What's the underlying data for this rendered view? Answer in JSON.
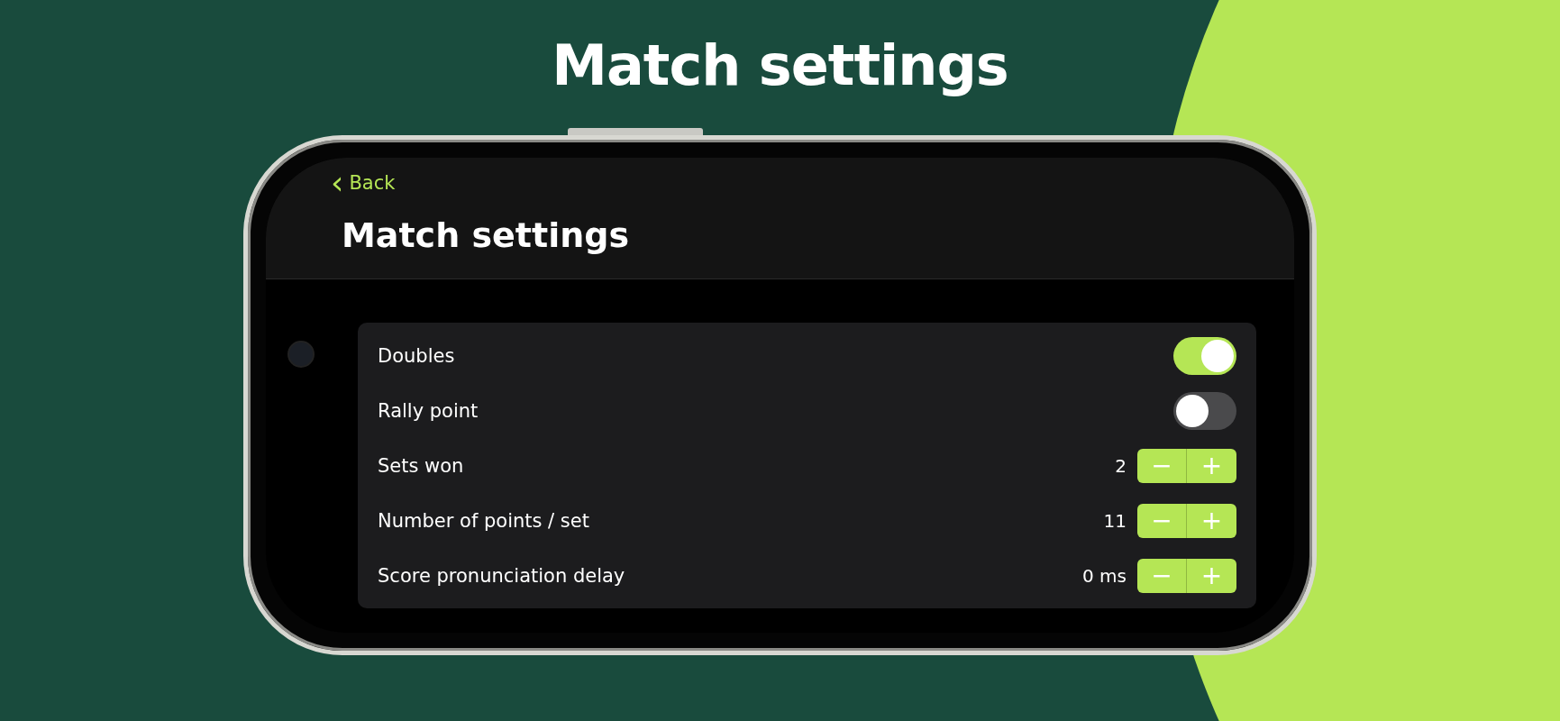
{
  "headline": "Match settings",
  "nav": {
    "back_icon": "‹",
    "back": "Back",
    "title": "Match settings"
  },
  "settings": [
    {
      "kind": "toggle",
      "label": "Doubles",
      "on": true
    },
    {
      "kind": "toggle",
      "label": "Rally point",
      "on": false
    },
    {
      "kind": "stepper",
      "label": "Sets won",
      "value": "2",
      "minus": "−",
      "plus": "+"
    },
    {
      "kind": "stepper",
      "label": "Number of points / set",
      "value": "11",
      "minus": "−",
      "plus": "+"
    },
    {
      "kind": "stepper",
      "label": "Score pronunciation delay",
      "value": "0 ms",
      "minus": "−",
      "plus": "+"
    }
  ]
}
